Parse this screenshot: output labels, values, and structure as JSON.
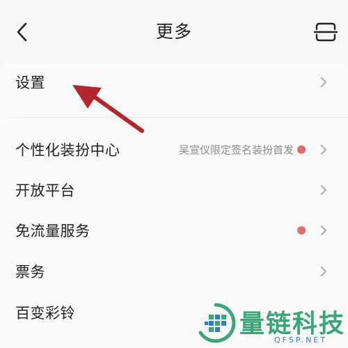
{
  "header": {
    "title": "更多",
    "back_icon": "back-arrow-icon",
    "action_icon": "scan-icon"
  },
  "menu": {
    "items": [
      {
        "label": "设置",
        "subtitle": "",
        "has_dot": false
      },
      {
        "label": "个性化装扮中心",
        "subtitle": "吴宣仪限定签名装扮首发",
        "has_dot": true
      },
      {
        "label": "开放平台",
        "subtitle": "",
        "has_dot": false
      },
      {
        "label": "免流量服务",
        "subtitle": "",
        "has_dot": true
      },
      {
        "label": "票务",
        "subtitle": "",
        "has_dot": false
      },
      {
        "label": "百变彩铃",
        "subtitle": "",
        "has_dot": false
      }
    ]
  },
  "watermark": {
    "brand": "量链科技",
    "domain": "QFSP.NET"
  },
  "colors": {
    "background": "#f6f6f6",
    "dot": "#e56a6a",
    "annotation_arrow": "#b3262b",
    "watermark_green": "#3aa57a",
    "watermark_blue": "#2f7fc1"
  }
}
